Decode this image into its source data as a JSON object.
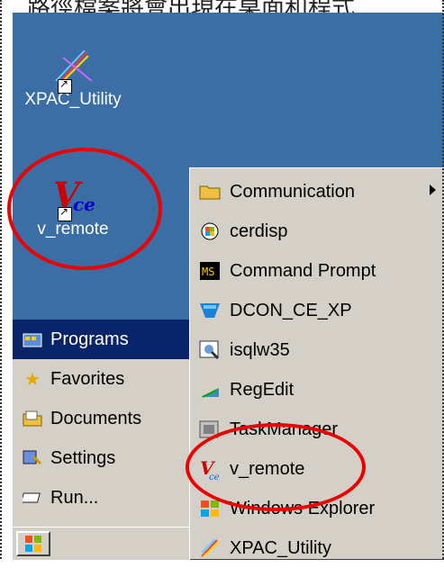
{
  "caption": "路徑檔案將會出現在桌面和程式",
  "desktop_icons": [
    {
      "label": "XPAC_Utility"
    },
    {
      "label": "v_remote"
    }
  ],
  "start_menu": [
    {
      "label": "Programs",
      "key": "P",
      "rest": "rograms",
      "active": true
    },
    {
      "label": "Favorites",
      "key": "a",
      "pre": "F",
      "rest": "vorites"
    },
    {
      "label": "Documents",
      "key": "D",
      "rest": "ocuments"
    },
    {
      "label": "Settings",
      "key": "S",
      "rest": "ettings"
    },
    {
      "label": "Run...",
      "key": "R",
      "rest": "un..."
    }
  ],
  "programs_submenu": [
    {
      "label": "Communication"
    },
    {
      "label": "cerdisp"
    },
    {
      "label": "Command Prompt"
    },
    {
      "label": "DCON_CE_XP"
    },
    {
      "label": "isqlw35"
    },
    {
      "label": "RegEdit"
    },
    {
      "label": "TaskManager"
    },
    {
      "label": "v_remote"
    },
    {
      "label": "Windows Explorer"
    },
    {
      "label": "XPAC_Utility"
    }
  ],
  "colors": {
    "desktop": "#3a6ea5",
    "menu": "#d4d0c8",
    "highlight": "#0a246a",
    "annotation": "#e00000"
  }
}
